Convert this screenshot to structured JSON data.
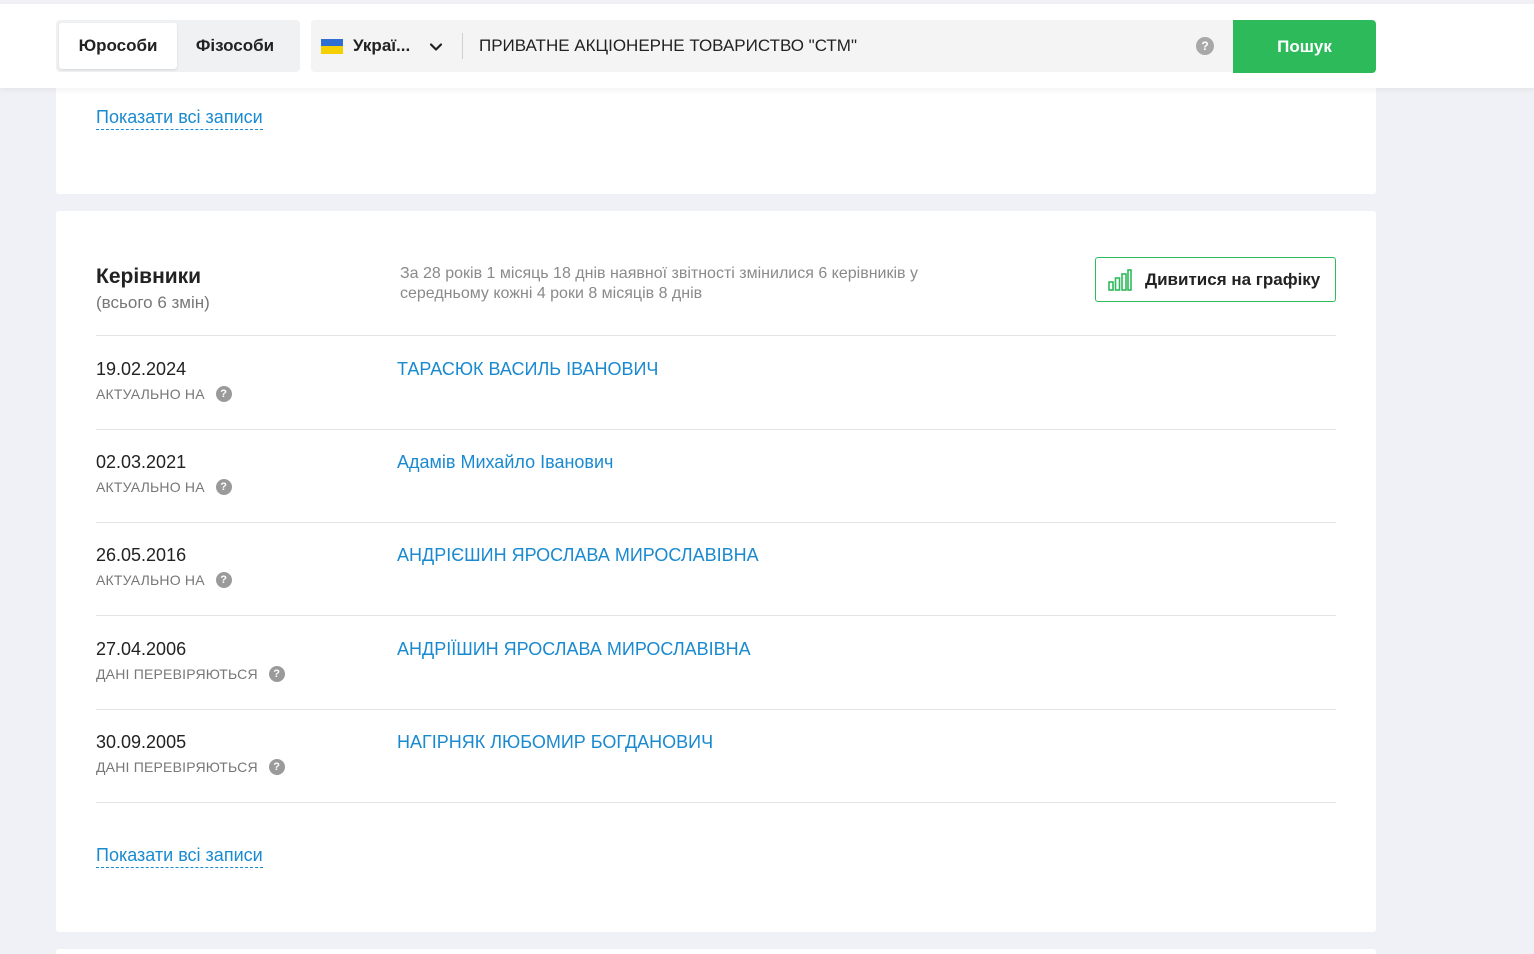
{
  "header": {
    "tabs": [
      {
        "label": "Юрособи",
        "active": true
      },
      {
        "label": "Фізособи",
        "active": false
      }
    ],
    "country": {
      "label": "Украї...",
      "flag": "ukraine-flag-icon"
    },
    "query": {
      "value": "ПРИВАТНЕ АКЦІОНЕРНЕ ТОВАРИСТВО \"СТМ\"",
      "help": "?"
    },
    "search_button": "Пошук"
  },
  "section_prev": {
    "show_all": "Показати всі записи"
  },
  "managers": {
    "title": "Керівники",
    "subtitle": "(всього 6 змін)",
    "description": "За 28 років 1 місяць 18 днів наявної звітності змінилися 6 керівників у середньому кожні 4 роки 8 місяців 8 днів",
    "chart_button": "Дивитися на графіку",
    "rows": [
      {
        "date": "19.02.2024",
        "status": "АКТУАЛЬНО НА",
        "name": "ТАРАСЮК ВАСИЛЬ ІВАНОВИЧ"
      },
      {
        "date": "02.03.2021",
        "status": "АКТУАЛЬНО НА",
        "name": "Адамів Михайло Іванович"
      },
      {
        "date": "26.05.2016",
        "status": "АКТУАЛЬНО НА",
        "name": "АНДРІЄШИН ЯРОСЛАВА МИРОСЛАВІВНА"
      },
      {
        "date": "27.04.2006",
        "status": "ДАНІ ПЕРЕВІРЯЮТЬСЯ",
        "name": "АНДРІЇШИН ЯРОСЛАВА МИРОСЛАВІВНА"
      },
      {
        "date": "30.09.2005",
        "status": "ДАНІ ПЕРЕВІРЯЮТЬСЯ",
        "name": "НАГІРНЯК ЛЮБОМИР БОГДАНОВИЧ"
      }
    ],
    "show_all": "Показати всі записи",
    "help_mark": "?"
  },
  "colors": {
    "accent_green": "#2dba5b",
    "link_blue": "#1a8ad0",
    "page_bg": "#f0f1f6"
  }
}
